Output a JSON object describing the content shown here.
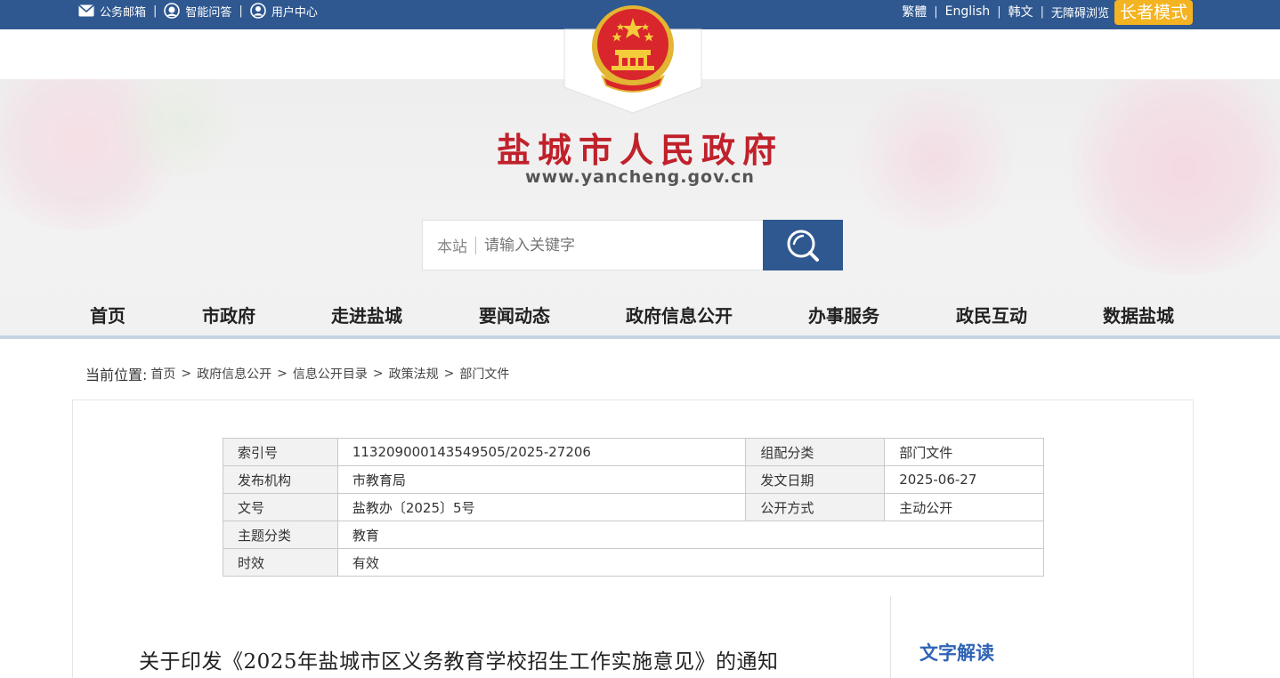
{
  "topbar": {
    "links": [
      "公务邮箱",
      "智能问答",
      "用户中心"
    ],
    "right_links": [
      "繁體",
      "English",
      "韩文",
      "无障碍浏览"
    ],
    "elder_mode": "长者模式"
  },
  "header": {
    "title": "盐城市人民政府",
    "url": "www.yancheng.gov.cn"
  },
  "search": {
    "scope": "本站",
    "placeholder": "请输入关键字"
  },
  "nav": [
    "首页",
    "市政府",
    "走进盐城",
    "要闻动态",
    "政府信息公开",
    "办事服务",
    "政民互动",
    "数据盐城"
  ],
  "breadcrumb": {
    "label": "当前位置:",
    "items": [
      "首页",
      "政府信息公开",
      "信息公开目录",
      "政策法规",
      "部门文件"
    ]
  },
  "meta": {
    "index_label": "索引号",
    "index_value": "113209000143549505/2025-27206",
    "category_label": "组配分类",
    "category_value": "部门文件",
    "publisher_label": "发布机构",
    "publisher_value": "市教育局",
    "date_label": "发文日期",
    "date_value": "2025-06-27",
    "docno_label": "文号",
    "docno_value": "盐教办〔2025〕5号",
    "openness_label": "公开方式",
    "openness_value": "主动公开",
    "topic_label": "主题分类",
    "topic_value": "教育",
    "validity_label": "时效",
    "validity_value": "有效"
  },
  "document": {
    "title": "关于印发《2025年盐城市区义务教育学校招生工作实施意见》的通知",
    "sidebar_title": "文字解读"
  },
  "colors": {
    "topbar": "#2f5890",
    "elder_button": "#f4b321",
    "title_red": "#c0212b",
    "sidebar_blue": "#2f64b5"
  }
}
